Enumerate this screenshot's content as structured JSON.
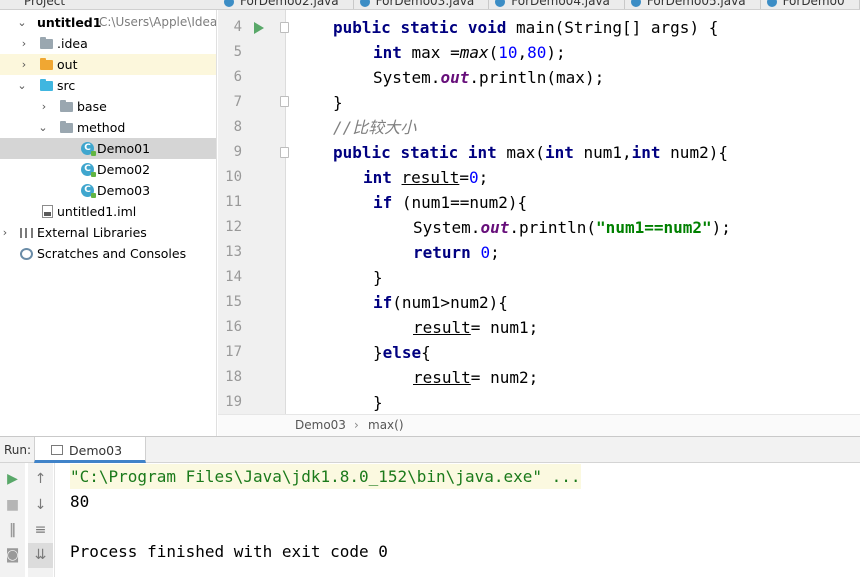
{
  "project_panel": {
    "title": "Project",
    "tree": [
      {
        "label": "untitled1",
        "path": "C:\\Users\\Apple\\IdeaP"
      },
      {
        "label": ".idea"
      },
      {
        "label": "out"
      },
      {
        "label": "src"
      },
      {
        "label": "base"
      },
      {
        "label": "method"
      },
      {
        "label": "Demo01"
      },
      {
        "label": "Demo02"
      },
      {
        "label": "Demo03"
      },
      {
        "label": "untitled1.iml"
      },
      {
        "label": "External Libraries"
      },
      {
        "label": "Scratches and Consoles"
      }
    ]
  },
  "editor_tabs": [
    "ForDemo02.java",
    "ForDemo03.java",
    "ForDemo04.java",
    "ForDemo05.java",
    "ForDemo0"
  ],
  "editor": {
    "line_numbers": [
      "4",
      "5",
      "6",
      "7",
      "8",
      "9",
      "10",
      "11",
      "12",
      "13",
      "14",
      "15",
      "16",
      "17",
      "18",
      "19"
    ],
    "lines": [
      [
        [
          "k",
          "public "
        ],
        [
          "k",
          "static "
        ],
        [
          "k",
          "void "
        ],
        [
          "",
          "main(String[] args) {"
        ]
      ],
      [
        [
          "k",
          "int "
        ],
        [
          "",
          "max ="
        ],
        [
          "it",
          "max"
        ],
        [
          "",
          "("
        ],
        [
          "n",
          "10"
        ],
        [
          "",
          ","
        ],
        [
          "n",
          "80"
        ],
        [
          "",
          ");"
        ]
      ],
      [
        [
          "",
          "System."
        ],
        [
          "f",
          "out"
        ],
        [
          "",
          ".println(max);"
        ]
      ],
      [
        [
          "",
          "}"
        ]
      ],
      [
        [
          "c",
          "//比较大小"
        ]
      ],
      [
        [
          "k",
          "public "
        ],
        [
          "k",
          "static "
        ],
        [
          "k",
          "int "
        ],
        [
          "",
          "max("
        ],
        [
          "k",
          "int "
        ],
        [
          "",
          "num1,"
        ],
        [
          "k",
          "int "
        ],
        [
          "",
          "num2){"
        ]
      ],
      [
        [
          "k",
          "int "
        ],
        [
          "u",
          "result"
        ],
        [
          "",
          "="
        ],
        [
          "n",
          "0"
        ],
        [
          "",
          ";"
        ]
      ],
      [
        [
          "k",
          "if "
        ],
        [
          "",
          "(num1==num2){"
        ]
      ],
      [
        [
          "",
          "System."
        ],
        [
          "f",
          "out"
        ],
        [
          "",
          ".println("
        ],
        [
          "s",
          "\"num1==num2\""
        ],
        [
          "",
          ");"
        ]
      ],
      [
        [
          "k",
          "return "
        ],
        [
          "n",
          "0"
        ],
        [
          "",
          ";"
        ]
      ],
      [
        [
          "",
          "}"
        ]
      ],
      [
        [
          "k",
          "if"
        ],
        [
          "",
          "(num1>num2){"
        ]
      ],
      [
        [
          "u",
          "result"
        ],
        [
          "",
          "= num1;"
        ]
      ],
      [
        [
          "",
          "}"
        ],
        [
          "k",
          "else"
        ],
        [
          "",
          "{"
        ]
      ],
      [
        [
          "u",
          "result"
        ],
        [
          "",
          "= num2;"
        ]
      ],
      [
        [
          "",
          "}"
        ]
      ]
    ]
  },
  "breadcrumb": {
    "file": "Demo03",
    "separator": "›",
    "method": "max()"
  },
  "run_panel": {
    "label": "Run:",
    "tab": "Demo03",
    "console": {
      "command": "\"C:\\Program Files\\Java\\jdk1.8.0_152\\bin\\java.exe\" ...",
      "output": "80",
      "exit": "Process finished with exit code 0"
    }
  },
  "icons": {
    "run": "run-icon",
    "stop": "stop-icon",
    "pause": "pause-icon",
    "camera": "camera-icon",
    "up": "arrow-up-icon",
    "down": "arrow-down-icon",
    "wrap": "soft-wrap-icon",
    "scroll": "scroll-to-end-icon"
  },
  "colors": {
    "keyword": "#000080",
    "number": "#0000ff",
    "string": "#008000",
    "comment": "#808080",
    "static_field": "#660e7a",
    "run_green": "#59a869"
  }
}
